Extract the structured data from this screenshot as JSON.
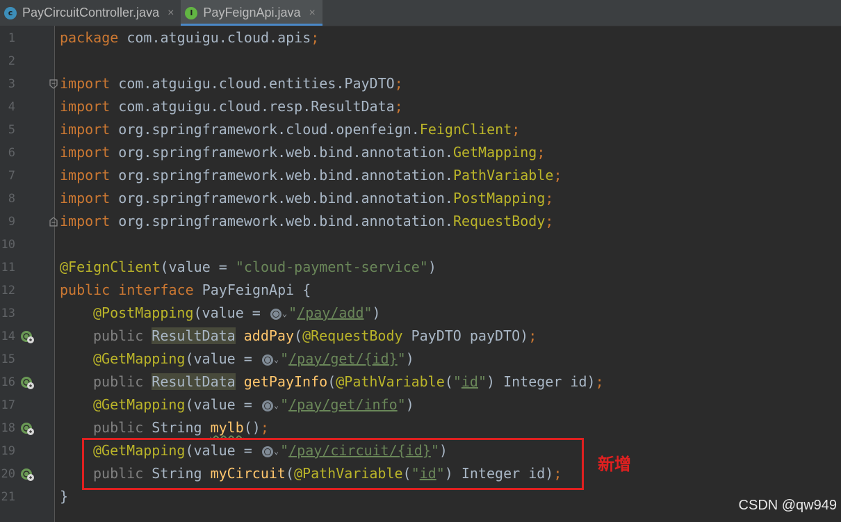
{
  "tabs": [
    {
      "name": "PayCircuitController.java",
      "icon": "class-file-icon",
      "active": false
    },
    {
      "name": "PayFeignApi.java",
      "icon": "interface-file-icon",
      "active": true
    }
  ],
  "tab_close": "×",
  "file_icon_letters": {
    "class": "c",
    "interface": "I"
  },
  "line_numbers": [
    "1",
    "2",
    "3",
    "4",
    "5",
    "6",
    "7",
    "8",
    "9",
    "10",
    "11",
    "12",
    "13",
    "14",
    "15",
    "16",
    "17",
    "18",
    "19",
    "20",
    "21"
  ],
  "code": {
    "l1": {
      "k": "package",
      "t": " com.atguigu.cloud.apis",
      "p": ";"
    },
    "l3": {
      "k": "import",
      "t": " com.atguigu.cloud.entities.PayDTO",
      "p": ";"
    },
    "l4": {
      "k": "import",
      "t": " com.atguigu.cloud.resp.ResultData",
      "p": ";"
    },
    "l5": {
      "k": "import",
      "t": " org.springframework.cloud.openfeign.",
      "c": "FeignClient",
      "p": ";"
    },
    "l6": {
      "k": "import",
      "t": " org.springframework.web.bind.annotation.",
      "c": "GetMapping",
      "p": ";"
    },
    "l7": {
      "k": "import",
      "t": " org.springframework.web.bind.annotation.",
      "c": "PathVariable",
      "p": ";"
    },
    "l8": {
      "k": "import",
      "t": " org.springframework.web.bind.annotation.",
      "c": "PostMapping",
      "p": ";"
    },
    "l9": {
      "k": "import",
      "t": " org.springframework.web.bind.annotation.",
      "c": "RequestBody",
      "p": ";"
    },
    "l11": {
      "a": "@FeignClient",
      "t1": "(value = ",
      "s": "\"cloud-payment-service\"",
      "t2": ")"
    },
    "l12": {
      "k1": "public",
      "k2": " interface",
      "t": " PayFeignApi {"
    },
    "l13": {
      "a": "@PostMapping",
      "t1": "(value = ",
      "q1": "\"",
      "u": "/pay/add",
      "q2": "\"",
      "t2": ")"
    },
    "l14": {
      "k": "public",
      "sp": " ",
      "r": "ResultData",
      "sp2": " ",
      "f": "addPay",
      "t1": "(",
      "a": "@RequestBody",
      "t2": " PayDTO payDTO)",
      "p": ";"
    },
    "l15": {
      "a": "@GetMapping",
      "t1": "(value = ",
      "q1": "\"",
      "u": "/pay/get/{id}",
      "q2": "\"",
      "t2": ")"
    },
    "l16": {
      "k": "public",
      "sp": " ",
      "r": "ResultData",
      "sp2": " ",
      "f": "getPayInfo",
      "t1": "(",
      "a": "@PathVariable",
      "t2": "(",
      "q1": "\"",
      "u": "id",
      "q2": "\"",
      "t3": ") Integer id)",
      "p": ";"
    },
    "l17": {
      "a": "@GetMapping",
      "t1": "(value = ",
      "q1": "\"",
      "u": "/pay/get/info",
      "q2": "\"",
      "t2": ")"
    },
    "l18": {
      "k": "public",
      "t": " String ",
      "f": "mylb",
      "t2": "()",
      "p": ";"
    },
    "l19": {
      "a": "@GetMapping",
      "t1": "(value = ",
      "q1": "\"",
      "u": "/pay/circuit/{id}",
      "q2": "\"",
      "t2": ")"
    },
    "l20": {
      "k": "public",
      "t": " String ",
      "f": "myCircuit",
      "t1": "(",
      "a": "@PathVariable",
      "t2": "(",
      "q1": "\"",
      "u": "id",
      "q2": "\"",
      "t3": ") Integer id)",
      "p": ";"
    },
    "l21": {
      "t": "}"
    }
  },
  "chevron": "⌄",
  "annotation_note": "新增",
  "watermark": "CSDN @qw949",
  "colors": {
    "background": "#2b2b2b",
    "keyword": "#cc7832",
    "annotation": "#bbb529",
    "string": "#6a8759",
    "method": "#ffc66d",
    "highlight_box": "#e02020"
  }
}
